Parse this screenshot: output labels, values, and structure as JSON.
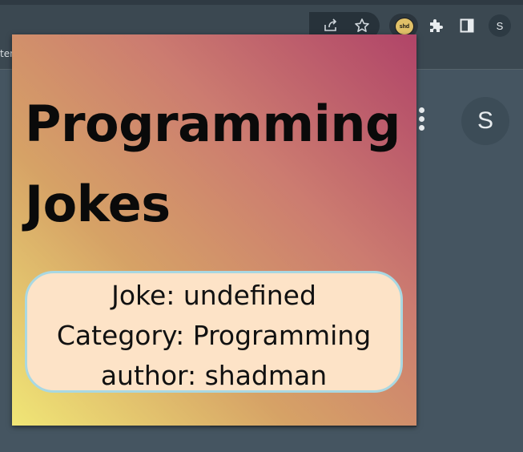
{
  "browser": {
    "bookmark_fragment": "ter",
    "profile_initial": "S",
    "extension_badge": "shd",
    "icons": [
      "share-icon",
      "star-icon",
      "puzzle-icon",
      "side-panel-icon",
      "kebab-menu-icon"
    ]
  },
  "popup": {
    "title": "Programming Jokes",
    "joke_line": "Joke: undefined",
    "category_line": "Category: Programming",
    "author_line": "author: shadman"
  },
  "colors": {
    "background": "#455561",
    "gradient_top_right": "#b04468",
    "gradient_bottom_left": "#f0e676",
    "card_background": "#fde3c7",
    "card_border": "#a9d8e2"
  }
}
